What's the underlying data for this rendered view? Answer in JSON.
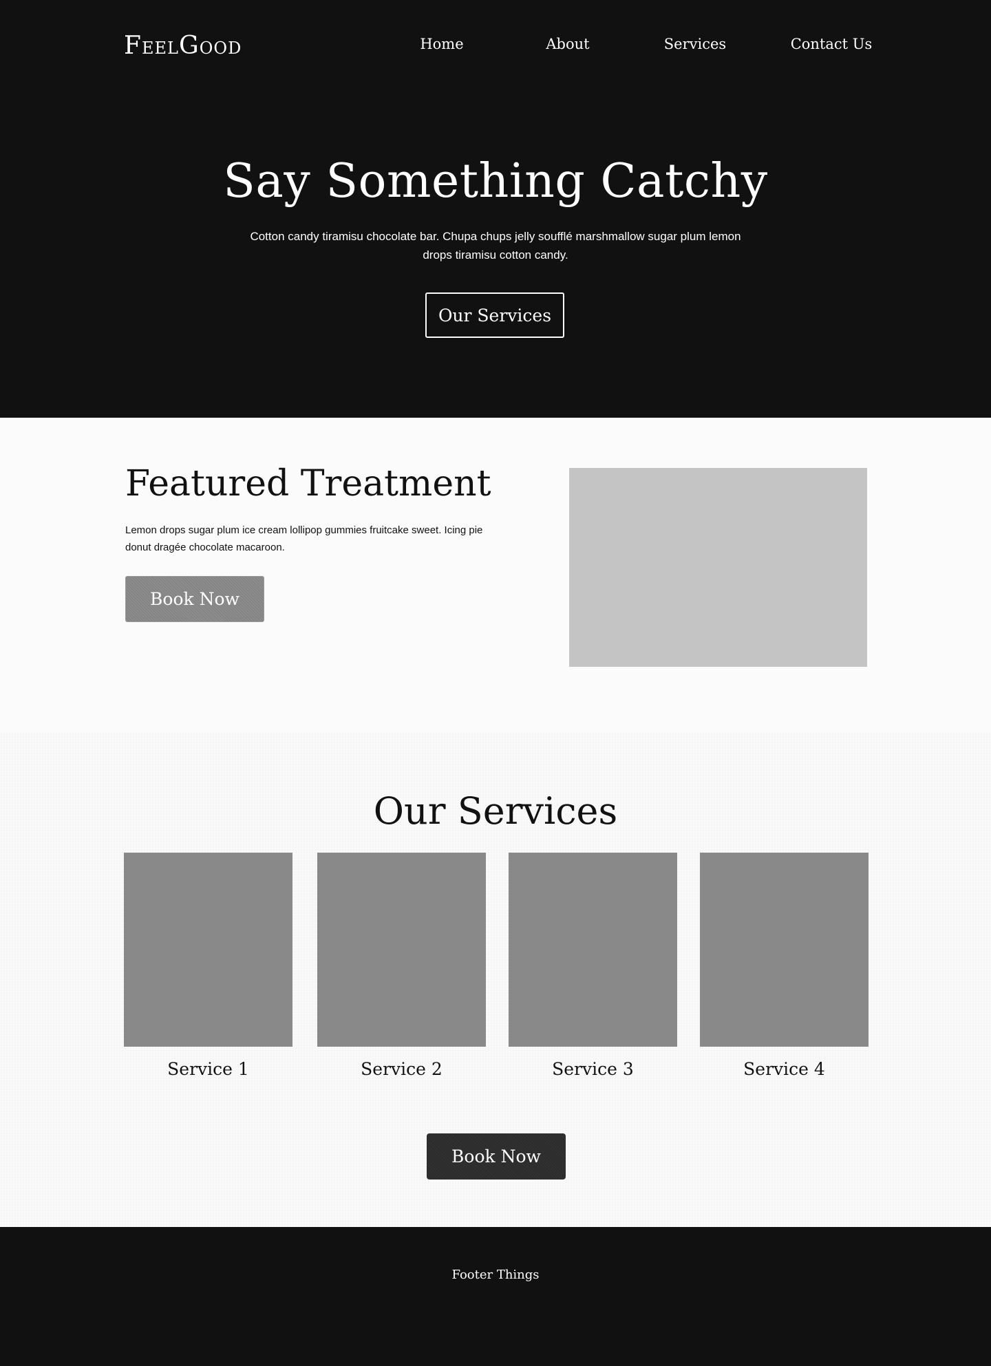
{
  "header": {
    "logo_first_initial": "F",
    "logo_first_rest": "EEL",
    "logo_second_initial": "G",
    "logo_second_rest": "OOD",
    "nav": [
      {
        "label": "Home"
      },
      {
        "label": "About"
      },
      {
        "label": "Services"
      },
      {
        "label": "Contact Us"
      }
    ]
  },
  "hero": {
    "title": "Say Something Catchy",
    "subtitle": "Cotton candy tiramisu chocolate bar. Chupa chups jelly soufflé marshmallow sugar plum lemon drops tiramisu cotton candy.",
    "button_label": "Our Services"
  },
  "featured": {
    "title": "Featured Treatment",
    "text": "Lemon drops sugar plum ice cream lollipop gummies fruitcake sweet. Icing pie donut dragée chocolate macaroon.",
    "button_label": "Book Now"
  },
  "services": {
    "title": "Our Services",
    "items": [
      {
        "label": "Service 1"
      },
      {
        "label": "Service 2"
      },
      {
        "label": "Service 3"
      },
      {
        "label": "Service 4"
      }
    ],
    "button_label": "Book Now"
  },
  "footer": {
    "text": "Footer Things"
  },
  "colors": {
    "dark_background": "#111111",
    "light_background": "#fbfbfb",
    "image_placeholder_light": "#c4c4c4",
    "image_placeholder_dark": "#898989",
    "dark_button": "#2c2c2c"
  }
}
